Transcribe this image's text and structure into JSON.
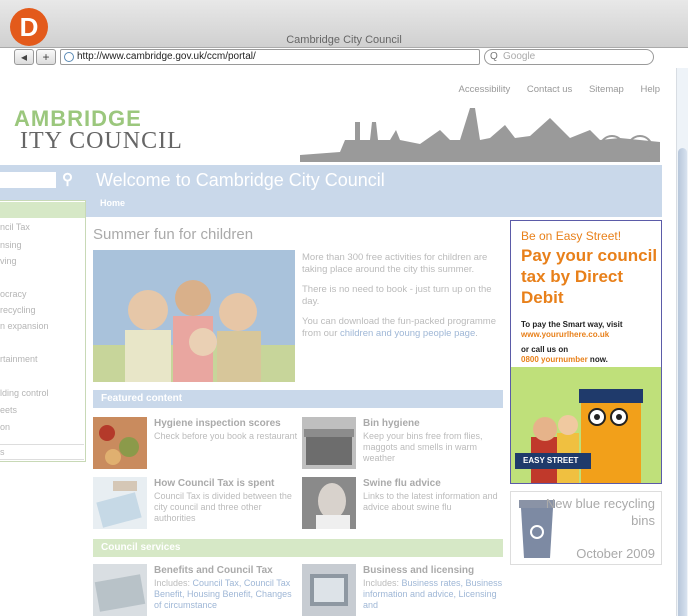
{
  "browser": {
    "window_title": "Cambridge City Council",
    "url": "http://www.cambridge.gov.uk/ccm/portal/",
    "search_placeholder": "Google",
    "back_label": "◂",
    "add_label": "+"
  },
  "badge": {
    "letter": "D"
  },
  "utility_nav": [
    "Accessibility",
    "Contact us",
    "Sitemap",
    "Help"
  ],
  "logo": {
    "line1": "AMBRIDGE",
    "line2": "ITY COUNCIL"
  },
  "header": {
    "welcome": "Welcome to Cambridge City Council",
    "breadcrumb": "Home"
  },
  "sidebar": {
    "items": [
      "ncil Tax",
      "nsing",
      "ving",
      "ocracy",
      "recycling",
      "n expansion",
      "rtainment",
      "lding control",
      "eets",
      "on"
    ],
    "last": "s"
  },
  "main": {
    "title": "Summer fun for children",
    "intro": [
      "More than 300 free activities for children are taking place around the city this summer.",
      "There is no need to book - just turn up on the day."
    ],
    "intro_download_pre": "You can download the fun-packed programme from our ",
    "intro_download_link": "children and young people page",
    "intro_download_post": "."
  },
  "featured": {
    "heading": "Featured content",
    "tiles": [
      {
        "title": "Hygiene inspection scores",
        "desc": "Check before you book a restaurant"
      },
      {
        "title": "Bin hygiene",
        "desc": "Keep your bins free from flies, maggots and smells in warm weather"
      },
      {
        "title": "How Council Tax is spent",
        "desc": "Council Tax is divided between the city council and three other authorities"
      },
      {
        "title": "Swine flu advice",
        "desc": "Links to the latest information and advice about swine flu"
      }
    ]
  },
  "council_services": {
    "heading": "Council services",
    "tiles": [
      {
        "title": "Benefits and Council Tax",
        "includes": "Includes: ",
        "links": "Council Tax, Council Tax Benefit, Housing Benefit, Changes of circumstance"
      },
      {
        "title": "Business and licensing",
        "includes": "Includes: ",
        "links": "Business rates, Business information and advice, Licensing and"
      }
    ]
  },
  "ad": {
    "top": "Be on Easy Street!",
    "headline": "Pay your council tax by Direct Debit",
    "sub": "To pay the Smart way, visit",
    "url": "www.yoururlhere.co.uk",
    "call": "or call us on",
    "phone": "0800 yournumber",
    "phone_suffix": " now.",
    "sign": "EASY STREET"
  },
  "bins_promo": {
    "text": "New blue recycling bins",
    "month": "October 2009"
  },
  "colors": {
    "badge": "#e35a1b",
    "header_blue": "#c9d8ea",
    "green_bar": "#d6e8c6",
    "ad_orange": "#e8801a",
    "ad_border": "#5b5ba8"
  }
}
